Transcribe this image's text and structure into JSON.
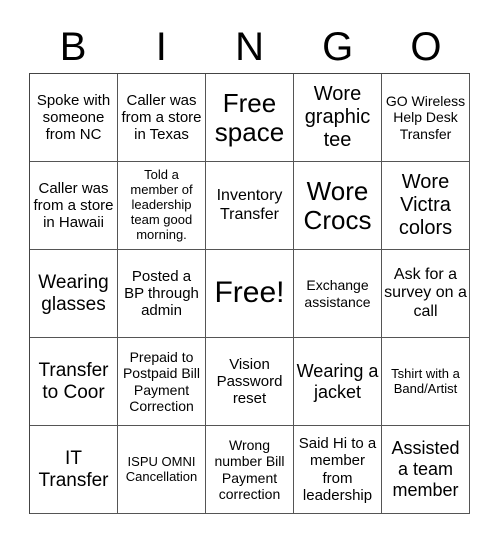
{
  "header": {
    "letters": [
      "B",
      "I",
      "N",
      "G",
      "O"
    ]
  },
  "cells": [
    "Spoke with someone from NC",
    "Caller was from a store in Texas",
    "Free space",
    "Wore graphic tee",
    "GO Wireless Help Desk Transfer",
    "Caller was from a store in Hawaii",
    "Told a member of leadership team good morning.",
    "Inventory Transfer",
    "Wore Crocs",
    "Wore Victra colors",
    "Wearing glasses",
    "Posted a BP through admin",
    "Free!",
    "Exchange assistance",
    "Ask for a survey on a call",
    "Transfer to Coor",
    "Prepaid to Postpaid Bill Payment Correction",
    "Vision Password reset",
    "Wearing a jacket",
    "Tshirt with a Band/Artist",
    "IT Transfer",
    "ISPU OMNI Cancellation",
    "Wrong number Bill Payment correction",
    "Said Hi to a member from leadership",
    "Assisted a team member"
  ]
}
